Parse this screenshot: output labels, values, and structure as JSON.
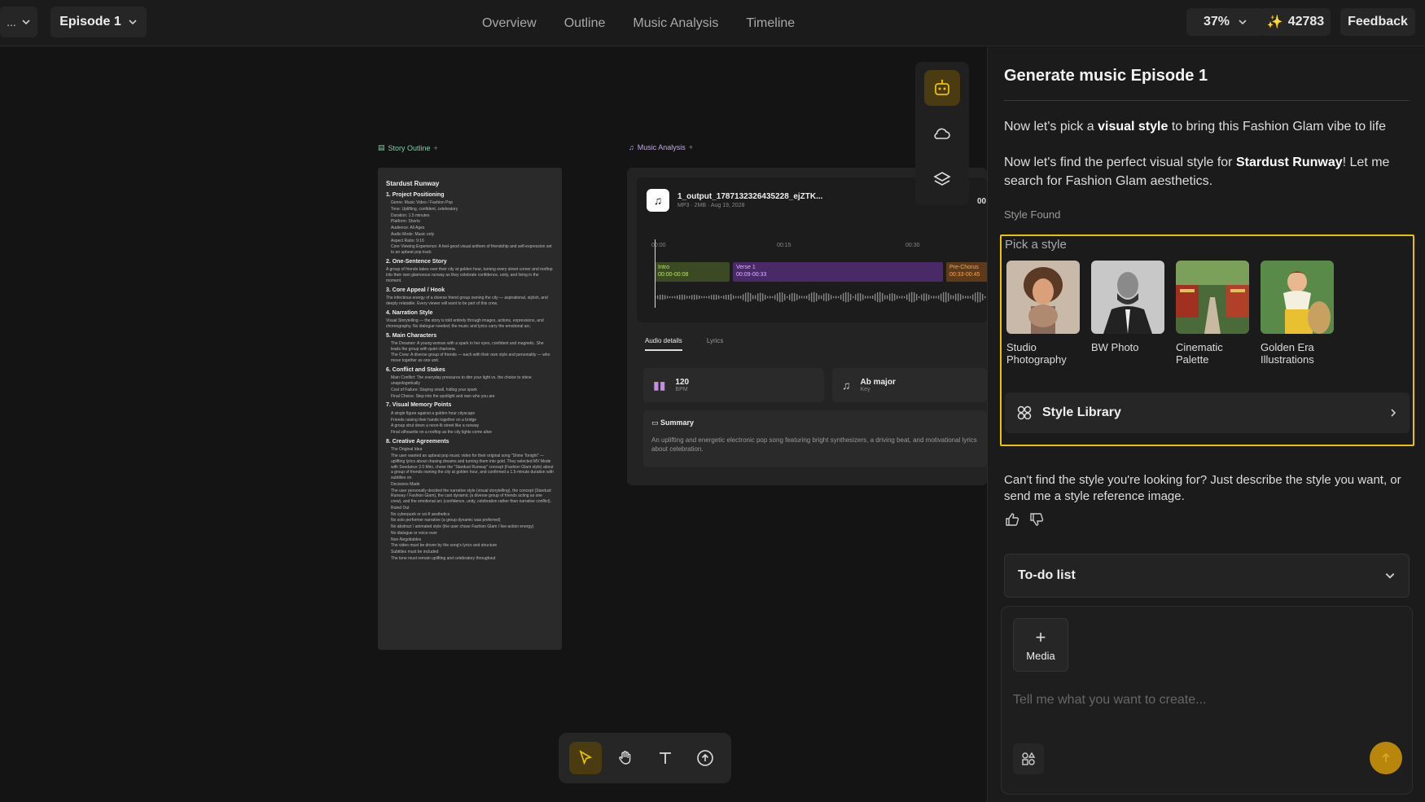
{
  "topbar": {
    "left_menu": "...",
    "episode": "Episode 1",
    "nav": [
      "Overview",
      "Outline",
      "Music Analysis",
      "Timeline"
    ],
    "zoom": "37%",
    "credits": "42783",
    "feedback": "Feedback"
  },
  "canvas": {
    "story_label": "Story Outline",
    "music_label": "Music Analysis",
    "story": {
      "title": "Stardust Runway",
      "sections": [
        {
          "h": "1. Project Positioning",
          "lines": [
            "Genre: Music Video / Fashion Pop",
            "Tone: Uplifting, confident, celebratory",
            "Duration: 1.5 minutes",
            "Platform: Shorts",
            "Audience: All Ages",
            "Audio Mode: Music only",
            "Aspect Ratio: 9:16",
            "Core Viewing Experience: A feel-good visual anthem of friendship and self-expression set to an upbeat pop track"
          ]
        },
        {
          "h": "2. One-Sentence Story",
          "lines": [
            "A group of friends takes over their city at golden hour, turning every street corner and rooftop into their own glamorous runway as they celebrate confidence, unity, and living in the moment."
          ]
        },
        {
          "h": "3. Core Appeal / Hook",
          "lines": [
            "The infectious energy of a diverse friend group owning the city — aspirational, stylish, and deeply relatable. Every viewer will want to be part of this crew."
          ]
        },
        {
          "h": "4. Narration Style",
          "lines": [
            "Visual Storytelling — the story is told entirely through images, actions, expressions, and choreography. No dialogue needed; the music and lyrics carry the emotional arc."
          ]
        },
        {
          "h": "5. Main Characters",
          "lines": [
            "The Dreamer: A young woman with a spark in her eyes, confident and magnetic. She leads the group with quiet charisma.",
            "The Crew: A diverse group of friends — each with their own style and personality — who move together as one unit."
          ]
        },
        {
          "h": "6. Conflict and Stakes",
          "lines": [
            "Main Conflict: The everyday pressures to dim your light vs. the choice to shine unapologetically",
            "Cost of Failure: Staying small, hiding your spark",
            "Final Choice: Step into the spotlight and own who you are"
          ]
        },
        {
          "h": "7. Visual Memory Points",
          "lines": [
            "A single figure against a golden hour cityscape",
            "Friends raising their hands together on a bridge",
            "A group strut down a neon-lit street like a runway",
            "Final silhouette on a rooftop as the city lights come alive"
          ]
        },
        {
          "h": "8. Creative Agreements",
          "lines": [
            "The Original Idea",
            "The user wanted an upbeat pop music video for their original song \"Shine Tonight\" — uplifting lyrics about chasing dreams and turning them into gold. They selected MV Mode with Seedance 2.0 Mini, chose the \"Stardust Runway\" concept (Fashion Glam style) about a group of friends owning the city at golden hour, and confirmed a 1.5-minute duration with subtitles on.",
            "Decisions Made",
            "The user personally decided the narrative style (visual storytelling), the concept (Stardust Runway / Fashion Glam), the cast dynamic (a diverse group of friends acting as one crew), and the emotional arc (confidence, unity, celebration rather than narrative conflict).",
            "Ruled Out",
            "No cyberpunk or sci-fi aesthetics",
            "No solo performer narrative (a group dynamic was preferred)",
            "No abstract / animated style (the user chose Fashion Glam / live-action energy)",
            "No dialogue or voice-over",
            "Non-Negotiables",
            "The video must be driven by the song's lyrics and structure",
            "Subtitles must be included",
            "The tone must remain uplifting and celebratory throughout"
          ]
        }
      ]
    },
    "music": {
      "file_name": "1_output_1787132326435228_ejZTK...",
      "file_meta": "MP3 · 2MB · Aug 19, 2028",
      "time_extra": "00",
      "timecodes": [
        "00:00",
        "00:15",
        "00:30"
      ],
      "segments": [
        {
          "name": "Intro",
          "time": "00:00-00:08"
        },
        {
          "name": "Verse 1",
          "time": "00:09-00:33"
        },
        {
          "name": "Pre-Chorus",
          "time": "00:33-00:45"
        }
      ],
      "tabs": [
        "Audio details",
        "Lyrics"
      ],
      "bpm_value": "120",
      "bpm_label": "BPM",
      "key_value": "Ab major",
      "key_label": "Key",
      "summary_title": "Summary",
      "summary_text": "An uplifting and energetic electronic pop song featuring bright synthesizers, a driving beat, and motivational lyrics about celebration."
    }
  },
  "panel": {
    "title": "Generate music Episode 1",
    "msg1_pre": "Now let's pick a ",
    "msg1_bold": "visual style",
    "msg1_post": " to bring this Fashion Glam vibe to life",
    "msg2_pre": "Now let's find the perfect visual style for ",
    "msg2_bold": "Stardust Runway",
    "msg2_post": "! Let me search for Fashion Glam aesthetics.",
    "style_found": "Style Found",
    "pick_label": "Pick a style",
    "styles": [
      {
        "label": "Studio Photography"
      },
      {
        "label": "BW Photo"
      },
      {
        "label": "Cinematic Palette"
      },
      {
        "label": "Golden Era Illustrations"
      }
    ],
    "library": "Style Library",
    "cant_find": "Can't find the style you're looking for? Just describe the style you want, or send me a style reference image.",
    "todo": "To-do list",
    "media": "Media",
    "placeholder": "Tell me what you want to create..."
  }
}
